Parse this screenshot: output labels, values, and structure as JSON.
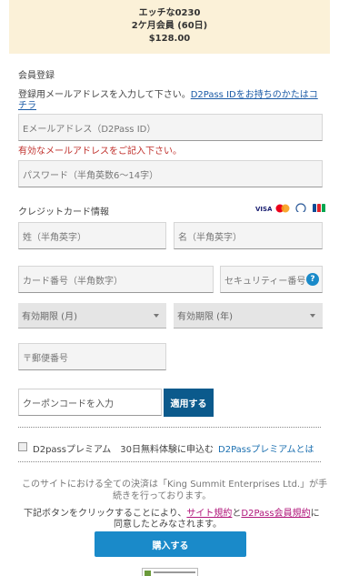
{
  "product": {
    "title": "エッチな0230",
    "plan": "2ケ月会員 (60日)",
    "price": "$128.00"
  },
  "membership": {
    "section_label": "会員登録",
    "instruction": "登録用メールアドレスを入力して下さい。",
    "existing_link_line1": "D2Pass IDをお持ちのかたはコ",
    "existing_link_line2": "チラ",
    "email_placeholder": "Eメールアドレス（D2Pass ID）",
    "email_error": "有効なメールアドレスをご記入下さい。",
    "password_placeholder": "パスワード（半角英数6～14字）"
  },
  "card": {
    "section_label": "クレジットカード情報",
    "brands": [
      "visa-icon",
      "mastercard-icon",
      "diners-icon",
      "jcb-icon"
    ],
    "brand_colors": {
      "visa": "#1a1f71",
      "mastercard_red": "#eb001b",
      "mastercard_yellow": "#f79e1b",
      "jcb": "#0e4c96"
    },
    "last_name_placeholder": "姓（半角英字）",
    "first_name_placeholder": "名（半角英字）",
    "number_placeholder": "カード番号（半角数字）",
    "cvv_placeholder": "セキュリティー番号",
    "help_symbol": "?",
    "exp_month_label": "有効期限 (月)",
    "exp_year_label": "有効期限 (年)",
    "postal_placeholder": "〒郵便番号"
  },
  "coupon": {
    "placeholder": "クーポンコードを入力",
    "apply_label": "適用する"
  },
  "premium": {
    "label": "D2passプレミアム　30日無料体験に申込む",
    "link": "D2Passプレミアムとは"
  },
  "notice": {
    "settlement_line1": "このサイトにおける全ての決済は「King Summit Enterprises Ltd.」が手",
    "settlement_line2": "続きを行っております。",
    "terms_prefix": "下記ボタンをクリックすることにより、",
    "site_terms_link": "サイト規約",
    "and": "と",
    "d2pass_terms_link": "D2Pass会員規約",
    "terms_suffix": "に",
    "terms_line2": "同意したとみなされます。"
  },
  "purchase_label": "購入する",
  "colors": {
    "accent": "#1a8ac9",
    "apply": "#0b5a8c",
    "error": "#c0302c",
    "link": "#1a5aa6",
    "header_bg": "#fbf1d8"
  }
}
